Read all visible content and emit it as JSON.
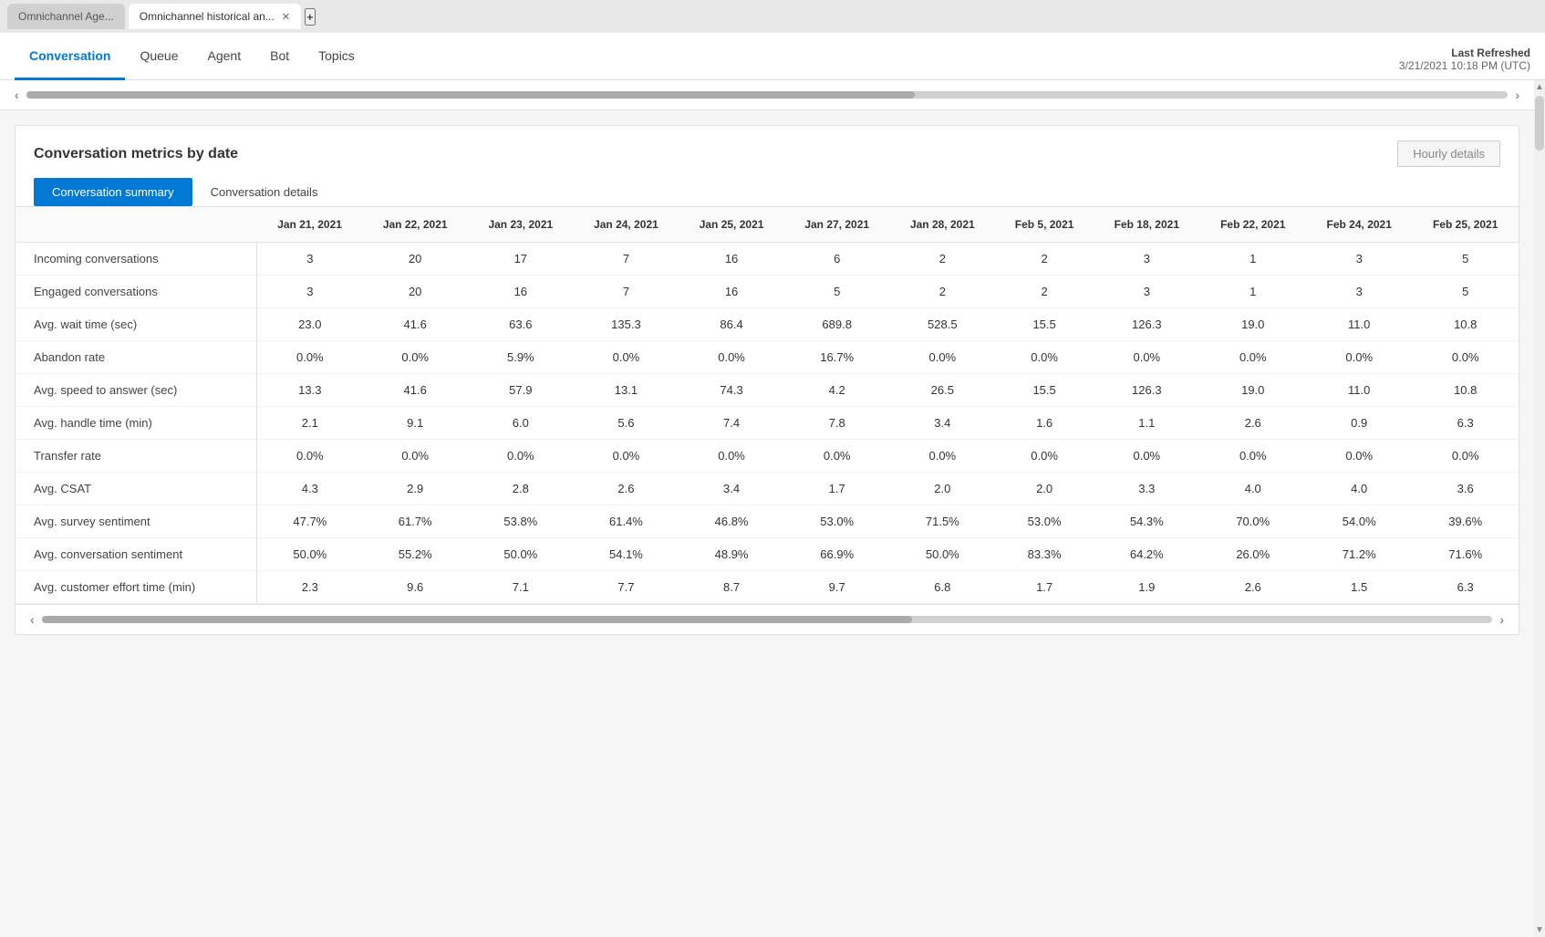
{
  "browser": {
    "tabs": [
      {
        "id": "tab1",
        "label": "Omnichannel Age...",
        "active": false,
        "closable": false
      },
      {
        "id": "tab2",
        "label": "Omnichannel historical an...",
        "active": true,
        "closable": true
      }
    ],
    "add_tab_label": "+"
  },
  "nav": {
    "tabs": [
      {
        "id": "conversation",
        "label": "Conversation",
        "active": true
      },
      {
        "id": "queue",
        "label": "Queue",
        "active": false
      },
      {
        "id": "agent",
        "label": "Agent",
        "active": false
      },
      {
        "id": "bot",
        "label": "Bot",
        "active": false
      },
      {
        "id": "topics",
        "label": "Topics",
        "active": false
      }
    ],
    "last_refreshed_label": "Last Refreshed",
    "last_refreshed_value": "3/21/2021 10:18 PM (UTC)"
  },
  "table_section": {
    "title": "Conversation metrics by date",
    "hourly_btn_label": "Hourly details",
    "sub_tabs": [
      {
        "id": "summary",
        "label": "Conversation summary",
        "active": true
      },
      {
        "id": "details",
        "label": "Conversation details",
        "active": false
      }
    ],
    "columns": [
      "Jan 21, 2021",
      "Jan 22, 2021",
      "Jan 23, 2021",
      "Jan 24, 2021",
      "Jan 25, 2021",
      "Jan 27, 2021",
      "Jan 28, 2021",
      "Feb 5, 2021",
      "Feb 18, 2021",
      "Feb 22, 2021",
      "Feb 24, 2021",
      "Feb 25, 2021"
    ],
    "rows": [
      {
        "label": "Incoming conversations",
        "values": [
          "3",
          "20",
          "17",
          "7",
          "16",
          "6",
          "2",
          "2",
          "3",
          "1",
          "3",
          "5"
        ]
      },
      {
        "label": "Engaged conversations",
        "values": [
          "3",
          "20",
          "16",
          "7",
          "16",
          "5",
          "2",
          "2",
          "3",
          "1",
          "3",
          "5"
        ]
      },
      {
        "label": "Avg. wait time (sec)",
        "values": [
          "23.0",
          "41.6",
          "63.6",
          "135.3",
          "86.4",
          "689.8",
          "528.5",
          "15.5",
          "126.3",
          "19.0",
          "11.0",
          "10.8"
        ]
      },
      {
        "label": "Abandon rate",
        "values": [
          "0.0%",
          "0.0%",
          "5.9%",
          "0.0%",
          "0.0%",
          "16.7%",
          "0.0%",
          "0.0%",
          "0.0%",
          "0.0%",
          "0.0%",
          "0.0%"
        ]
      },
      {
        "label": "Avg. speed to answer (sec)",
        "values": [
          "13.3",
          "41.6",
          "57.9",
          "13.1",
          "74.3",
          "4.2",
          "26.5",
          "15.5",
          "126.3",
          "19.0",
          "11.0",
          "10.8"
        ]
      },
      {
        "label": "Avg. handle time (min)",
        "values": [
          "2.1",
          "9.1",
          "6.0",
          "5.6",
          "7.4",
          "7.8",
          "3.4",
          "1.6",
          "1.1",
          "2.6",
          "0.9",
          "6.3"
        ]
      },
      {
        "label": "Transfer rate",
        "values": [
          "0.0%",
          "0.0%",
          "0.0%",
          "0.0%",
          "0.0%",
          "0.0%",
          "0.0%",
          "0.0%",
          "0.0%",
          "0.0%",
          "0.0%",
          "0.0%"
        ]
      },
      {
        "label": "Avg. CSAT",
        "values": [
          "4.3",
          "2.9",
          "2.8",
          "2.6",
          "3.4",
          "1.7",
          "2.0",
          "2.0",
          "3.3",
          "4.0",
          "4.0",
          "3.6"
        ]
      },
      {
        "label": "Avg. survey sentiment",
        "values": [
          "47.7%",
          "61.7%",
          "53.8%",
          "61.4%",
          "46.8%",
          "53.0%",
          "71.5%",
          "53.0%",
          "54.3%",
          "70.0%",
          "54.0%",
          "39.6%"
        ]
      },
      {
        "label": "Avg. conversation sentiment",
        "values": [
          "50.0%",
          "55.2%",
          "50.0%",
          "54.1%",
          "48.9%",
          "66.9%",
          "50.0%",
          "83.3%",
          "64.2%",
          "26.0%",
          "71.2%",
          "71.6%"
        ]
      },
      {
        "label": "Avg. customer effort time (min)",
        "values": [
          "2.3",
          "9.6",
          "7.1",
          "7.7",
          "8.7",
          "9.7",
          "6.8",
          "1.7",
          "1.9",
          "2.6",
          "1.5",
          "6.3"
        ]
      }
    ]
  }
}
